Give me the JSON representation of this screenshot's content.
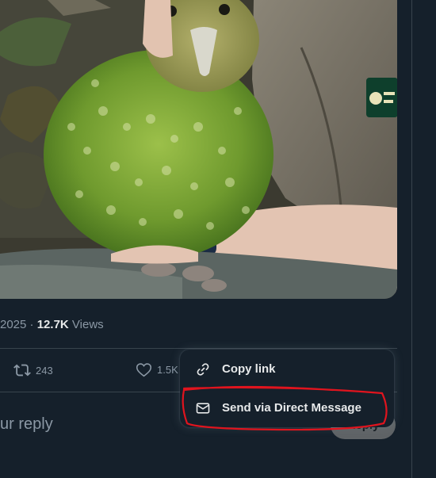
{
  "tweet": {
    "date_fragment": "2025",
    "separator": "·",
    "views_count": "12.7K",
    "views_label": "Views"
  },
  "actions": {
    "retweet_count": "243",
    "like_count": "1.5K"
  },
  "reply": {
    "placeholder": "ur reply",
    "button_label": "Reply"
  },
  "share_menu": {
    "items": [
      {
        "label": "Copy link",
        "icon": "link-icon"
      },
      {
        "label": "Send via Direct Message",
        "icon": "envelope-icon"
      }
    ]
  },
  "colors": {
    "background": "#15202b",
    "border": "#38444d",
    "muted_text": "#8b98a5",
    "highlight_annotation": "#e0141e"
  }
}
